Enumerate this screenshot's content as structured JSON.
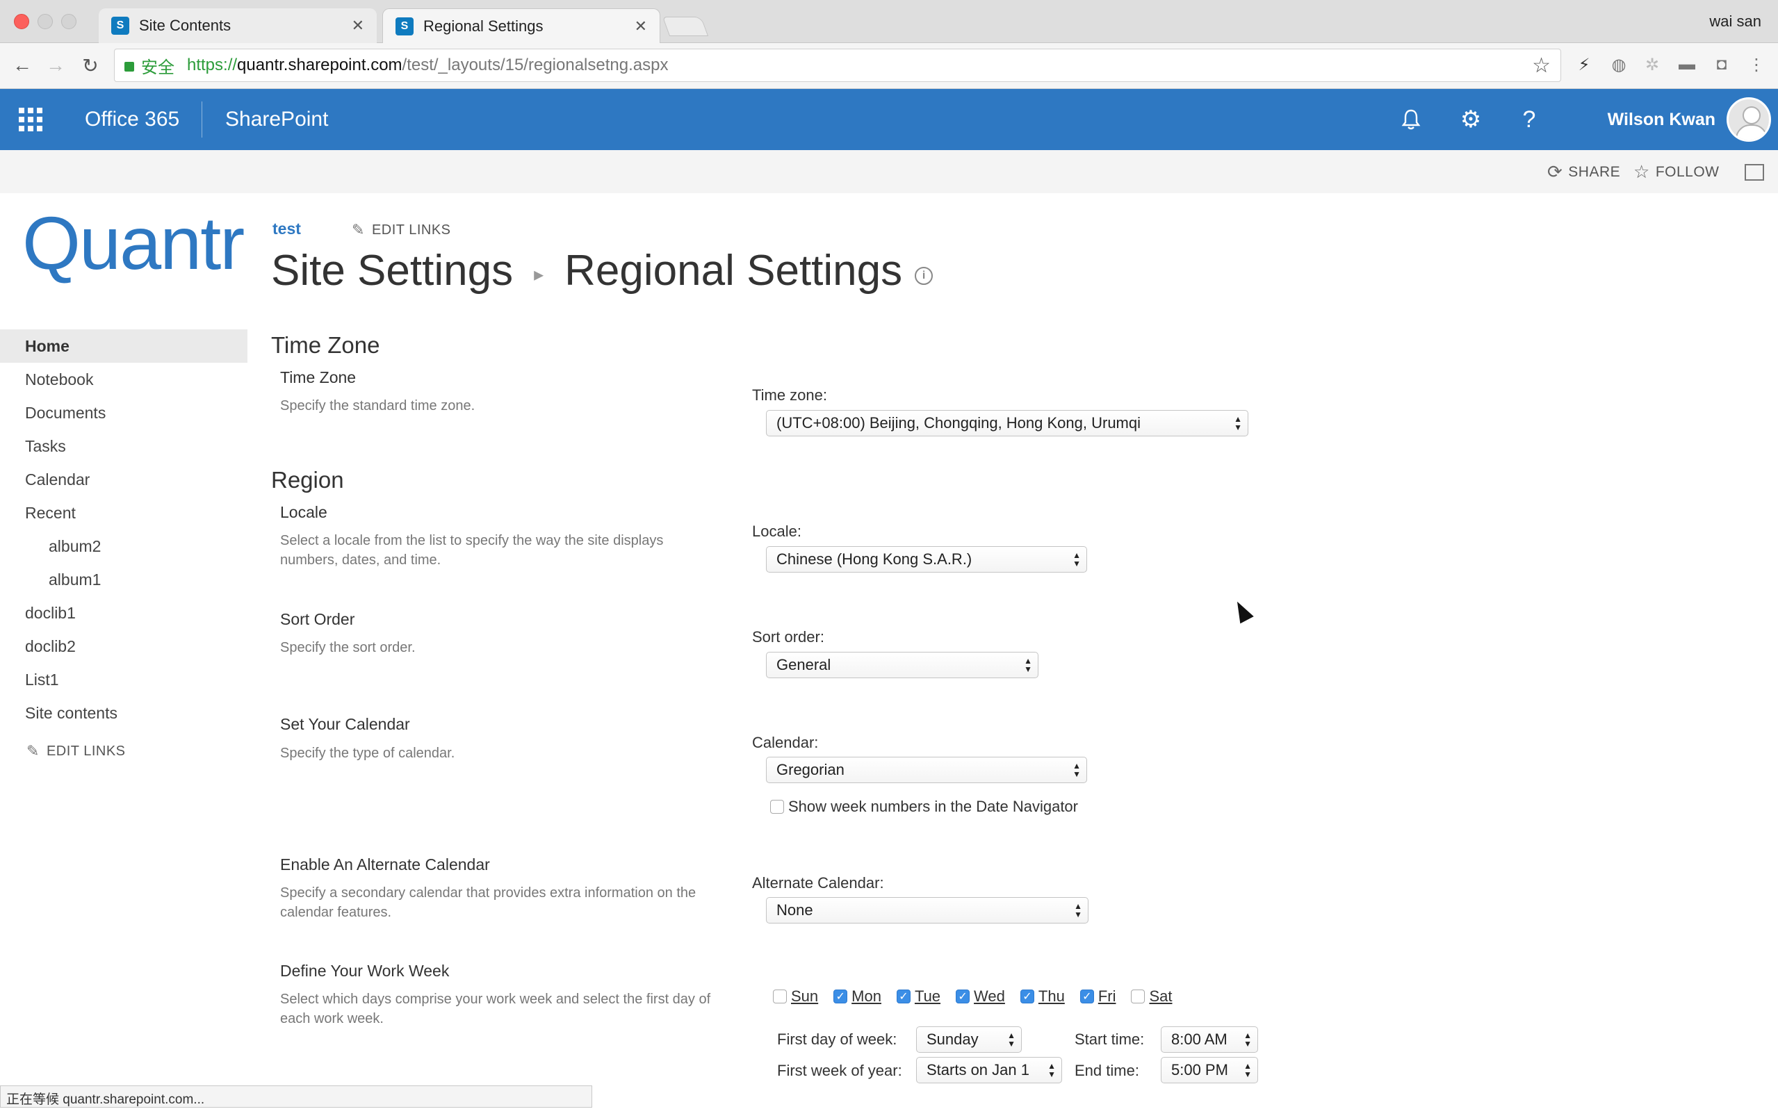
{
  "browser": {
    "tabs": [
      {
        "title": "Site Contents",
        "favicon": "S"
      },
      {
        "title": "Regional Settings",
        "favicon": "S"
      }
    ],
    "close_glyph": "✕",
    "profile": "wai san",
    "url": {
      "secure_label": "安全",
      "scheme": "https://",
      "host": "quantr.sharepoint.com",
      "path": "/test/_layouts/15/regionalsetng.aspx"
    },
    "status": "正在等候 quantr.sharepoint.com..."
  },
  "suitebar": {
    "brand": "Office 365",
    "app": "SharePoint",
    "user": "Wilson Kwan",
    "help": "?"
  },
  "ribbon": {
    "share": "SHARE",
    "follow": "FOLLOW"
  },
  "site": {
    "logo": "Quantr",
    "site_link": "test",
    "edit_links": "EDIT LINKS",
    "breadcrumb_root": "Site Settings",
    "page_title": "Regional Settings"
  },
  "leftnav": {
    "items": [
      "Home",
      "Notebook",
      "Documents",
      "Tasks",
      "Calendar",
      "Recent",
      "album2",
      "album1",
      "doclib1",
      "doclib2",
      "List1",
      "Site contents"
    ],
    "edit_links": "EDIT LINKS"
  },
  "time_zone": {
    "section": "Time Zone",
    "title": "Time Zone",
    "desc": "Specify the standard time zone.",
    "label": "Time zone:",
    "value": "(UTC+08:00) Beijing, Chongqing, Hong Kong, Urumqi"
  },
  "region": {
    "section": "Region",
    "locale": {
      "title": "Locale",
      "desc": "Select a locale from the list to specify the way the site displays numbers, dates, and time.",
      "label": "Locale:",
      "value": "Chinese (Hong Kong S.A.R.)"
    },
    "sort": {
      "title": "Sort Order",
      "desc": "Specify the sort order.",
      "label": "Sort order:",
      "value": "General"
    },
    "calendar": {
      "title": "Set Your Calendar",
      "desc": "Specify the type of calendar.",
      "label": "Calendar:",
      "value": "Gregorian",
      "week_numbers": "Show week numbers in the Date Navigator"
    },
    "alternate": {
      "title": "Enable An Alternate Calendar",
      "desc": "Specify a secondary calendar that provides extra information on the calendar features.",
      "label": "Alternate Calendar:",
      "value": "None"
    },
    "work_week": {
      "title": "Define Your Work Week",
      "desc": "Select which days comprise your work week and select the first day of each work week.",
      "days": [
        {
          "label": "Sun",
          "checked": false
        },
        {
          "label": "Mon",
          "checked": true
        },
        {
          "label": "Tue",
          "checked": true
        },
        {
          "label": "Wed",
          "checked": true
        },
        {
          "label": "Thu",
          "checked": true
        },
        {
          "label": "Fri",
          "checked": true
        },
        {
          "label": "Sat",
          "checked": false
        }
      ],
      "first_day_label": "First day of week:",
      "first_day_value": "Sunday",
      "first_week_label": "First week of year:",
      "first_week_value": "Starts on Jan 1",
      "start_label": "Start time:",
      "start_value": "8:00 AM",
      "end_label": "End time:",
      "end_value": "5:00 PM"
    }
  },
  "colors": {
    "suite_bar": "#2e78c2",
    "accent": "#2e78c2",
    "checkbox_on": "#3b8ee6"
  }
}
